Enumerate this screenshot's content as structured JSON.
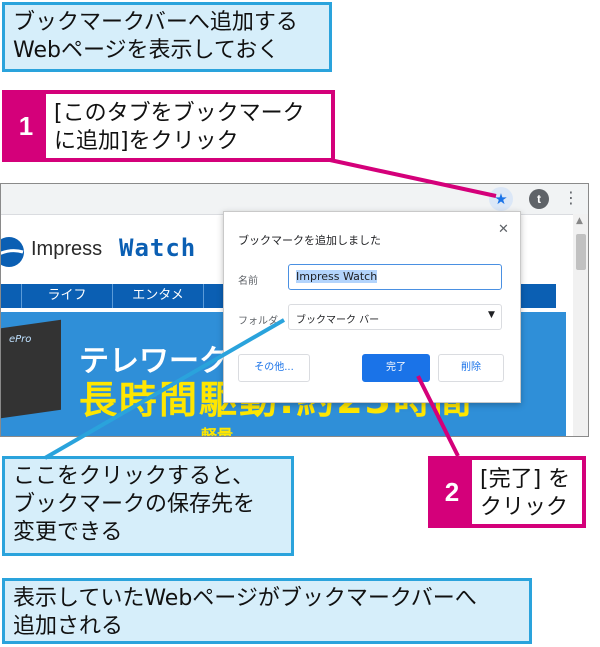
{
  "callouts": {
    "top": "ブックマークバーへ追加する\nWebページを表示しておく",
    "left": "ここをクリックすると、\nブックマークの保存先を\n変更できる",
    "bottom": "表示していたWebページがブックマークバーへ\n追加される"
  },
  "steps": [
    {
      "number": "1",
      "text": "[このタブをブックマーク\nに追加]をクリック"
    },
    {
      "number": "2",
      "text": "[完了] を\nクリック"
    }
  ],
  "browser": {
    "avatar_letter": "t",
    "star_icon": "star-icon",
    "menu_icon": "more-vertical-icon"
  },
  "site": {
    "logo_name": "Impress",
    "logo_watch": "Watch",
    "nav": [
      "ライフ",
      "エンタメ"
    ],
    "banner_line1": "テレワークに",
    "banner_line2": "長時間駆動:約23時間",
    "banner_line3": "軽量",
    "laptop_label": "ePro"
  },
  "popup": {
    "title": "ブックマークを追加しました",
    "name_label": "名前",
    "name_value": "Impress Watch",
    "folder_label": "フォルダ",
    "folder_value": "ブックマーク バー",
    "more_button": "その他...",
    "done_button": "完了",
    "delete_button": "削除"
  },
  "colors": {
    "accent_magenta": "#d4007a",
    "callout_border": "#2aa3dc",
    "callout_fill": "#d6eefa",
    "chrome_blue": "#1a73e8"
  }
}
